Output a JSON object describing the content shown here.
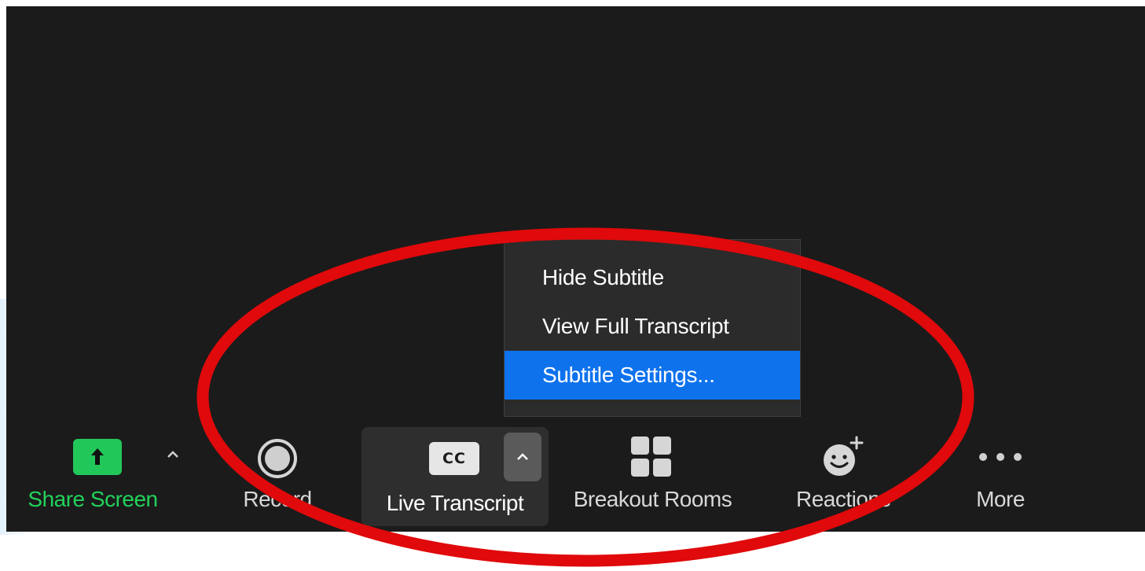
{
  "toolbar": {
    "share_screen": {
      "label": "Share Screen",
      "icon": "arrow-up-icon"
    },
    "record": {
      "label": "Record",
      "icon": "record-icon"
    },
    "live_transcript": {
      "label": "Live Transcript",
      "icon_text": "CC"
    },
    "breakout_rooms": {
      "label": "Breakout Rooms",
      "icon": "grid-icon"
    },
    "reactions": {
      "label": "Reactions",
      "icon": "smiley-plus-icon"
    },
    "more": {
      "label": "More",
      "icon": "ellipsis-icon"
    }
  },
  "menu": {
    "items": [
      {
        "label": "Hide Subtitle",
        "selected": false
      },
      {
        "label": "View Full Transcript",
        "selected": false
      },
      {
        "label": "Subtitle Settings...",
        "selected": true
      }
    ]
  },
  "colors": {
    "background": "#1b1b1b",
    "share_green": "#22c75a",
    "menu_highlight": "#0e72ed",
    "annotation_red": "#e0090b"
  }
}
